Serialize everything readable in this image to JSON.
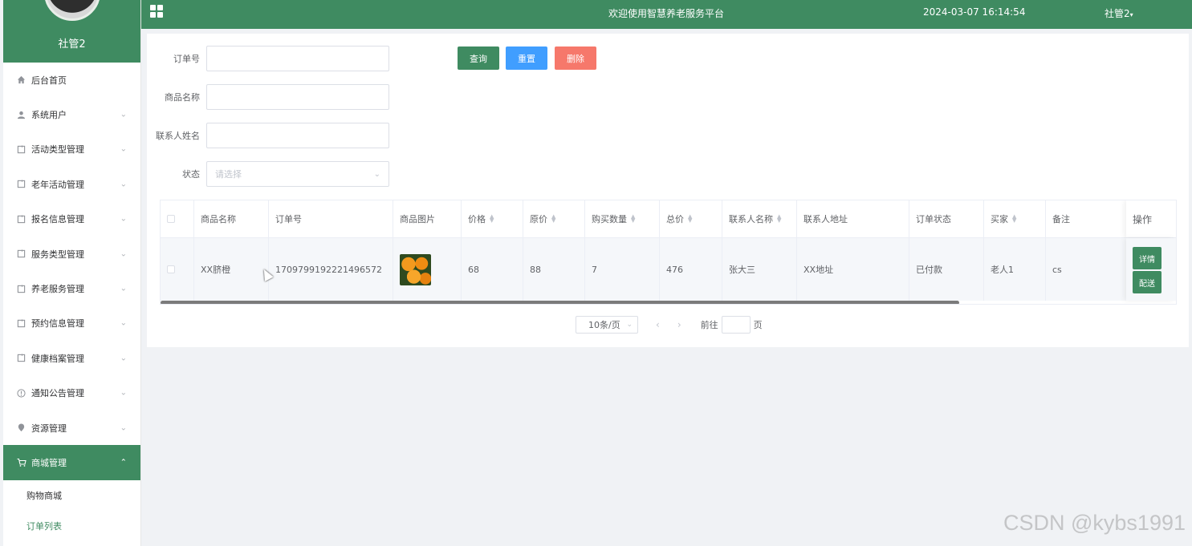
{
  "sidebar": {
    "username": "社管2",
    "items": [
      {
        "label": "后台首页",
        "icon": "home-icon"
      },
      {
        "label": "系统用户",
        "icon": "user-icon"
      },
      {
        "label": "活动类型管理",
        "icon": "document-icon"
      },
      {
        "label": "老年活动管理",
        "icon": "document-icon"
      },
      {
        "label": "报名信息管理",
        "icon": "document-icon"
      },
      {
        "label": "服务类型管理",
        "icon": "document-icon"
      },
      {
        "label": "养老服务管理",
        "icon": "document-icon"
      },
      {
        "label": "预约信息管理",
        "icon": "document-icon"
      },
      {
        "label": "健康档案管理",
        "icon": "document-icon"
      },
      {
        "label": "通知公告管理",
        "icon": "info-icon"
      },
      {
        "label": "资源管理",
        "icon": "location-icon"
      },
      {
        "label": "商城管理",
        "icon": "cart-icon"
      }
    ],
    "subitems": [
      {
        "label": "购物商城"
      },
      {
        "label": "订单列表"
      }
    ]
  },
  "topbar": {
    "title": "欢迎使用智慧养老服务平台",
    "datetime": "2024-03-07 16:14:54",
    "user": "社管2"
  },
  "filters": {
    "order_no_label": "订单号",
    "product_name_label": "商品名称",
    "contact_name_label": "联系人姓名",
    "status_label": "状态",
    "status_placeholder": "请选择"
  },
  "buttons": {
    "query": "查询",
    "reset": "重置",
    "delete": "删除"
  },
  "table": {
    "headers": [
      "商品名称",
      "订单号",
      "商品图片",
      "价格",
      "原价",
      "购买数量",
      "总价",
      "联系人名称",
      "联系人地址",
      "订单状态",
      "买家",
      "备注",
      "操作"
    ],
    "rows": [
      {
        "product_name": "XX脐橙",
        "order_no": "1709799192221496572",
        "price": "68",
        "original_price": "88",
        "quantity": "7",
        "total": "476",
        "contact_name": "张大三",
        "contact_address": "XX地址",
        "status": "已付款",
        "buyer": "老人1",
        "remark": "cs",
        "actions": [
          "详情",
          "配送"
        ]
      }
    ]
  },
  "pagination": {
    "page_size": "10条/页",
    "goto_label": "前往",
    "page_unit": "页"
  },
  "watermark": "CSDN @kybs1991",
  "colors": {
    "primary": "#3f8b61",
    "reset": "#409eff",
    "delete": "#f6786b"
  }
}
